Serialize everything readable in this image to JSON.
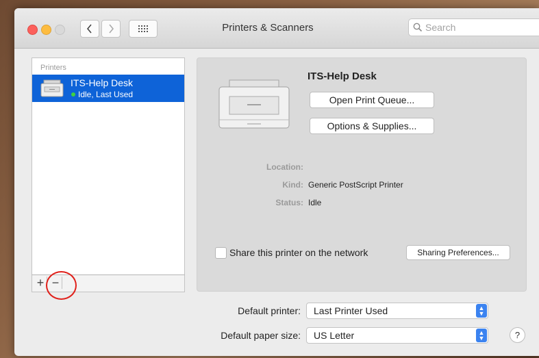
{
  "window": {
    "title": "Printers & Scanners",
    "search_placeholder": "Search"
  },
  "printers_list": {
    "header": "Printers",
    "items": [
      {
        "name": "ITS-Help Desk",
        "status": "Idle, Last Used",
        "status_color": "#3fd23f",
        "selected": true
      }
    ],
    "add_label": "+",
    "remove_label": "−"
  },
  "detail": {
    "printer_name": "ITS-Help Desk",
    "open_queue_label": "Open Print Queue...",
    "options_label": "Options & Supplies...",
    "location_label": "Location:",
    "location_value": "",
    "kind_label": "Kind:",
    "kind_value": "Generic PostScript Printer",
    "status_label": "Status:",
    "status_value": "Idle",
    "share_label": "Share this printer on the network",
    "share_checked": false,
    "sharing_prefs_label": "Sharing Preferences..."
  },
  "defaults": {
    "default_printer_label": "Default printer:",
    "default_printer_value": "Last Printer Used",
    "paper_size_label": "Default paper size:",
    "paper_size_value": "US Letter"
  },
  "help_label": "?",
  "colors": {
    "selection": "#0e63d8",
    "accent": "#3b83f0",
    "annotation_circle": "#e0201a"
  }
}
